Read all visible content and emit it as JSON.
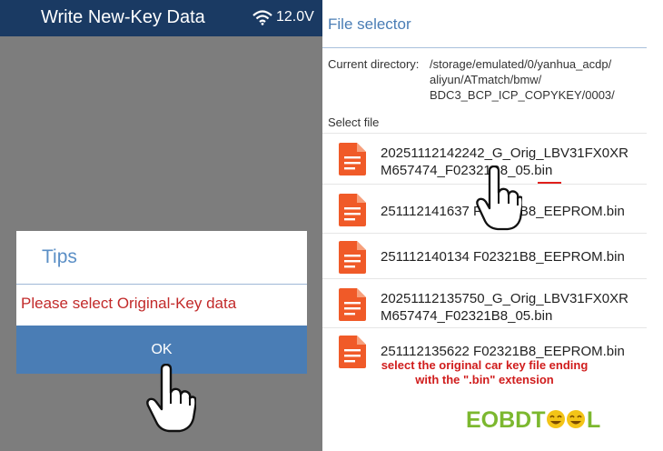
{
  "left_screen": {
    "title": "Write New-Key Data",
    "status": {
      "wifi_icon": "wifi-icon",
      "voltage": "12.0V"
    },
    "dialog": {
      "title": "Tips",
      "message": "Please select Original-Key data",
      "ok_label": "OK"
    }
  },
  "right_screen": {
    "title": "File selector",
    "current_directory_label": "Current directory:",
    "current_directory_lines": [
      "/storage/emulated/0/yanhua_acdp/",
      "aliyun/ATmatch/bmw/",
      "BDC3_BCP_ICP_COPYKEY/0003/"
    ],
    "select_file_label": "Select file",
    "files": [
      {
        "line1": "20251112142242_G_Orig_LBV31FX0XR",
        "line2": "M657474_F02321B8_05.bin"
      },
      {
        "line1": "251112141637 F02321B8_EEPROM.bin",
        "line2": ""
      },
      {
        "line1": "251112140134 F02321B8_EEPROM.bin",
        "line2": ""
      },
      {
        "line1": "20251112135750_G_Orig_LBV31FX0XR",
        "line2": "M657474_F02321B8_05.bin"
      },
      {
        "line1": "251112135622 F02321B8_EEPROM.bin",
        "line2": ""
      }
    ],
    "annotation_lines": [
      "select the original car key file ending",
      "with the \".bin\" extension"
    ],
    "watermark": "EOBDTOOL"
  },
  "colors": {
    "topbar": "#1a3a63",
    "dialog_button": "#4a7db5",
    "dialog_title": "#5b8fc6",
    "error_text": "#c22a2a",
    "file_icon": "#f05a28",
    "annotation": "#d01c1c",
    "logo_green": "#7cb82f"
  }
}
